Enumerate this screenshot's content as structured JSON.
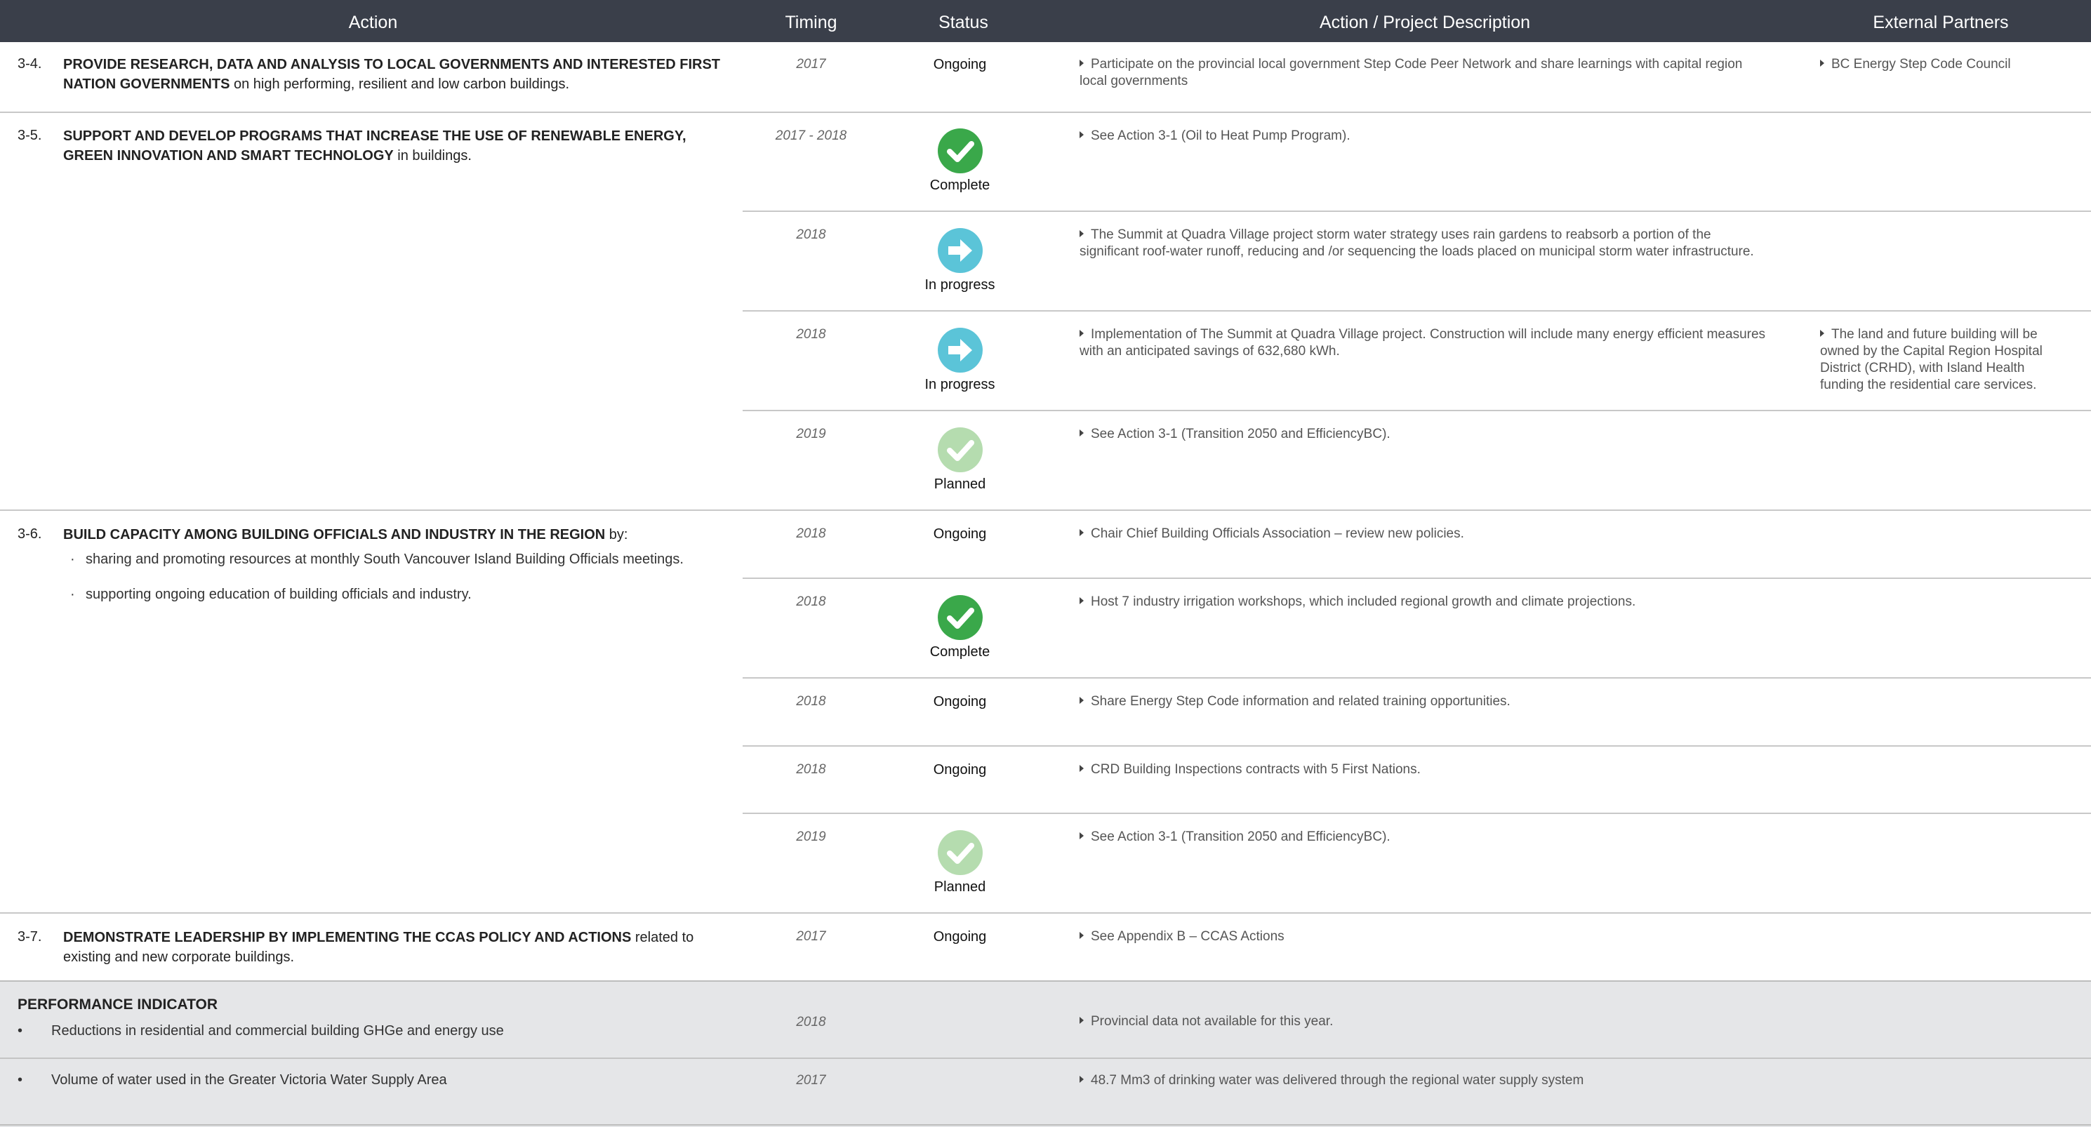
{
  "header": {
    "action": "Action",
    "timing": "Timing",
    "status": "Status",
    "description": "Action / Project Description",
    "partners": "External Partners"
  },
  "actions": {
    "a34": {
      "num": "3-4.",
      "bold": "PROVIDE RESEARCH, DATA AND ANALYSIS TO LOCAL GOVERNMENTS AND INTERESTED FIRST NATION GOVERNMENTS",
      "rest": " on high performing, resilient and low carbon buildings.",
      "rows": [
        {
          "timing": "2017",
          "status": "Ongoing",
          "description": "Participate on the provincial local government Step Code Peer Network and share learnings with capital region local governments",
          "partner": "BC Energy Step Code Council"
        }
      ]
    },
    "a35": {
      "num": "3-5.",
      "bold": "SUPPORT AND DEVELOP PROGRAMS THAT INCREASE THE USE OF RENEWABLE ENERGY, GREEN INNOVATION AND SMART TECHNOLOGY",
      "rest": " in buildings.",
      "rows": [
        {
          "timing": "2017 - 2018",
          "status": "Complete",
          "icon": "check-circle-icon",
          "description": "See Action 3-1 (Oil to Heat Pump Program)."
        },
        {
          "timing": "2018",
          "status": "In progress",
          "icon": "arrow-circle-icon",
          "description": "The Summit at Quadra Village project storm water strategy uses rain gardens to reabsorb a portion of the significant roof-water runoff, reducing and /or sequencing the loads placed on municipal storm water infrastructure."
        },
        {
          "timing": "2018",
          "status": "In progress",
          "icon": "arrow-circle-icon",
          "description": "Implementation of The Summit at Quadra Village project.  Construction will include many energy efficient measures with an anticipated savings of 632,680 kWh.",
          "partner": "The land and future building will be owned by the Capital Region Hospital District (CRHD), with Island Health funding the residential care services."
        },
        {
          "timing": "2019",
          "status": "Planned",
          "icon": "check-circle-light-icon",
          "description": "See Action 3-1 (Transition 2050 and  EfficiencyBC)."
        }
      ]
    },
    "a36": {
      "num": "3-6.",
      "bold": "BUILD CAPACITY AMONG BUILDING OFFICIALS AND INDUSTRY IN THE REGION",
      "rest": " by:",
      "bullets": [
        "sharing and promoting resources at monthly South Vancouver Island Building Officials meetings.",
        "supporting ongoing education of building officials and industry."
      ],
      "rows": [
        {
          "timing": "2018",
          "status": "Ongoing",
          "description": "Chair Chief Building Officials Association – review new policies."
        },
        {
          "timing": "2018",
          "status": "Complete",
          "icon": "check-circle-icon",
          "description": "Host 7 industry irrigation workshops, which included regional growth and climate projections."
        },
        {
          "timing": "2018",
          "status": "Ongoing",
          "description": "Share Energy Step Code information and related training opportunities."
        },
        {
          "timing": "2018",
          "status": "Ongoing",
          "description": "CRD Building Inspections contracts with 5 First Nations."
        },
        {
          "timing": "2019",
          "status": "Planned",
          "icon": "check-circle-light-icon",
          "description": "See Action 3-1 (Transition 2050 and EfficiencyBC)."
        }
      ]
    },
    "a37": {
      "num": "3-7.",
      "bold": "DEMONSTRATE LEADERSHIP BY IMPLEMENTING THE CCAS POLICY AND ACTIONS",
      "rest": " related to existing and new corporate buildings.",
      "rows": [
        {
          "timing": "2017",
          "status": "Ongoing",
          "description": "See Appendix B – CCAS Actions"
        }
      ]
    }
  },
  "performance": {
    "title": "PERFORMANCE INDICATOR",
    "bullet": "•",
    "items": [
      {
        "label": "Reductions in residential and commercial building GHGe and energy use",
        "timing": "2018",
        "description": "Provincial data not available for this year."
      },
      {
        "label": "Volume of water used in the Greater Victoria Water Supply Area",
        "timing": "2017",
        "description": "48.7 Mm3 of drinking water was delivered through the regional water supply system"
      }
    ]
  },
  "colors": {
    "header_bg": "#3a3f4a",
    "complete": "#3aa84a",
    "in_progress": "#5bc4d8",
    "planned": "#b5dcaf",
    "perf_bg": "#e5e6e8"
  }
}
